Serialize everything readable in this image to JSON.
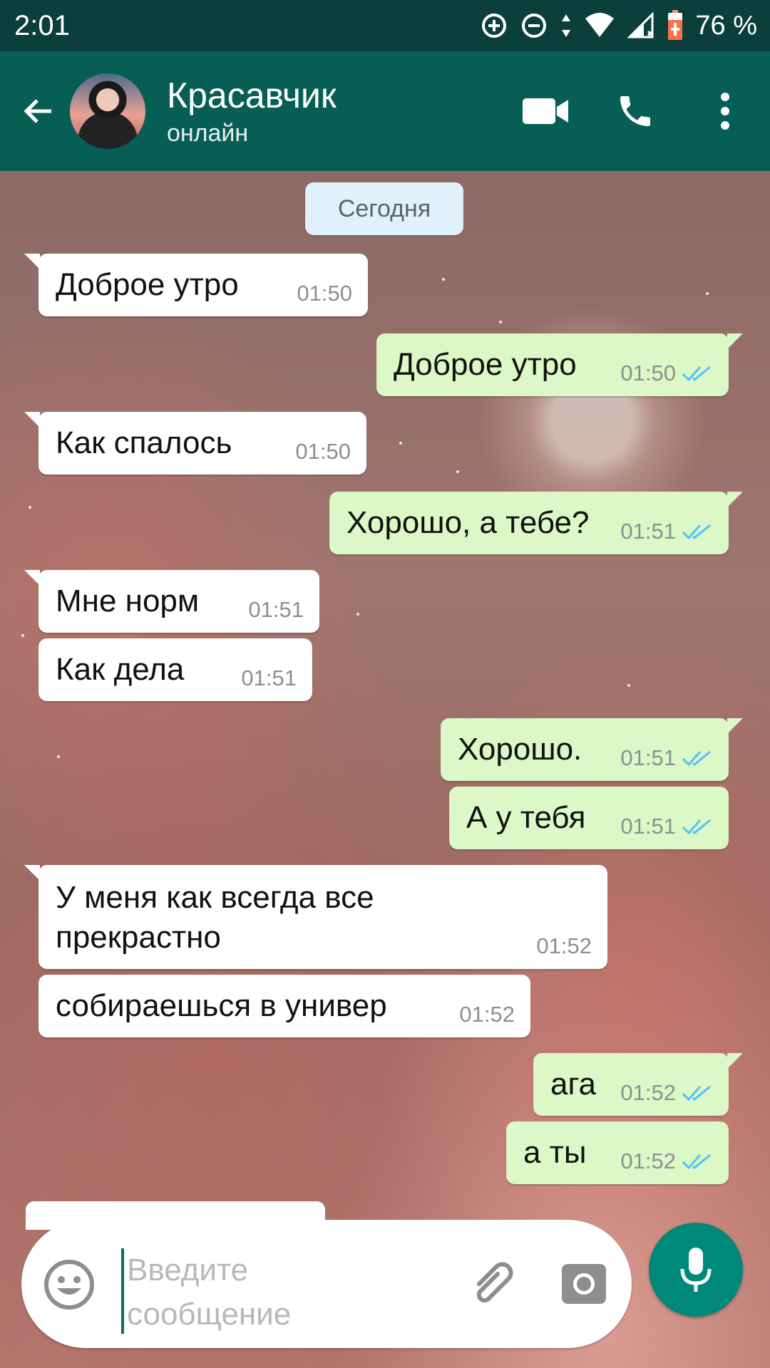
{
  "status_bar": {
    "time": "2:01",
    "battery": "76 %",
    "icons": [
      "data-saver-icon",
      "do-not-disturb-icon",
      "data-arrows-icon",
      "wifi-icon",
      "signal-icon",
      "battery-charging-icon"
    ]
  },
  "header": {
    "contact_name": "Красавчик",
    "contact_status": "онлайн",
    "icons": [
      "back-arrow-icon",
      "avatar",
      "video-call-icon",
      "phone-icon",
      "more-vert-icon"
    ]
  },
  "chat": {
    "date_divider": "Сегодня",
    "messages": [
      {
        "direction": "in",
        "text": "Доброе утро",
        "time": "01:50"
      },
      {
        "direction": "out",
        "text": "Доброе утро",
        "time": "01:50",
        "read": true
      },
      {
        "direction": "in",
        "text": "Как спалось",
        "time": "01:50"
      },
      {
        "direction": "out",
        "text": "Хорошо, а тебе?",
        "time": "01:51",
        "read": true
      },
      {
        "direction": "in",
        "text": "Мне норм",
        "time": "01:51"
      },
      {
        "direction": "in",
        "text": "Как дела",
        "time": "01:51"
      },
      {
        "direction": "out",
        "text": "Хорошо.",
        "time": "01:51",
        "read": true
      },
      {
        "direction": "out",
        "text": "А у тебя",
        "time": "01:51",
        "read": true
      },
      {
        "direction": "in",
        "text": "У меня как всегда все прекрастно",
        "time": "01:52"
      },
      {
        "direction": "in",
        "text": "собираешься в универ",
        "time": "01:52"
      },
      {
        "direction": "out",
        "text": "ага",
        "time": "01:52",
        "read": true
      },
      {
        "direction": "out",
        "text": "а ты",
        "time": "01:52",
        "read": true
      }
    ]
  },
  "composer": {
    "placeholder": "Введите сообщение",
    "value": ""
  },
  "colors": {
    "header": "#075e54",
    "status_bar": "#0a3f3c",
    "incoming_bubble": "#ffffff",
    "outgoing_bubble": "#dcf8c6",
    "read_ticks": "#4fc3f7",
    "mic_button": "#00897b"
  }
}
